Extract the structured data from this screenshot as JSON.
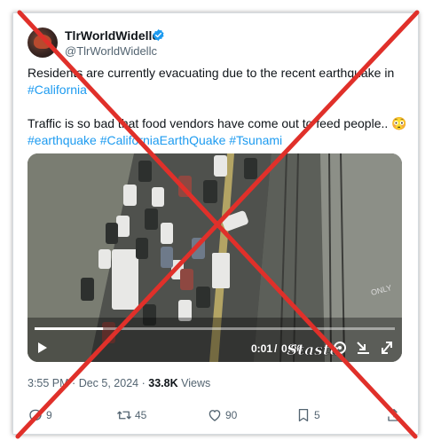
{
  "post": {
    "display_name": "TlrWorldWidellc",
    "handle": "@TlrWorldWidellc",
    "text_line1": "Residents are currently evacuating due to the recent earthquake in",
    "text_tag1": "#California",
    "text_line3": "Traffic is so bad that food vendors have come out to feed people.. 😳",
    "hashtags": "#earthquake #CaliforniaEarthQuake #Tsunami",
    "time": "3:55 PM",
    "date": "Dec 5, 2024",
    "separator": "·",
    "views_count": "33.8K",
    "views_label": "Views"
  },
  "video": {
    "current_time": "0:01",
    "duration": "0:06",
    "time_separator": "/",
    "progress_fraction": 0.19,
    "watermark_word": "ONLY",
    "overlay_stamp": "Stasta"
  },
  "actions": {
    "replies": "9",
    "reposts": "45",
    "likes": "90",
    "bookmarks": "5"
  },
  "colors": {
    "link": "#1d9bf0",
    "verified": "#1d9bf0",
    "cross": "#e0302a",
    "muted": "#536471"
  },
  "icons": [
    "verified-badge-icon",
    "play-icon",
    "volume-icon",
    "settings-icon",
    "minimize-icon",
    "fullscreen-icon",
    "reply-icon",
    "repost-icon",
    "like-icon",
    "bookmark-icon",
    "share-icon"
  ]
}
